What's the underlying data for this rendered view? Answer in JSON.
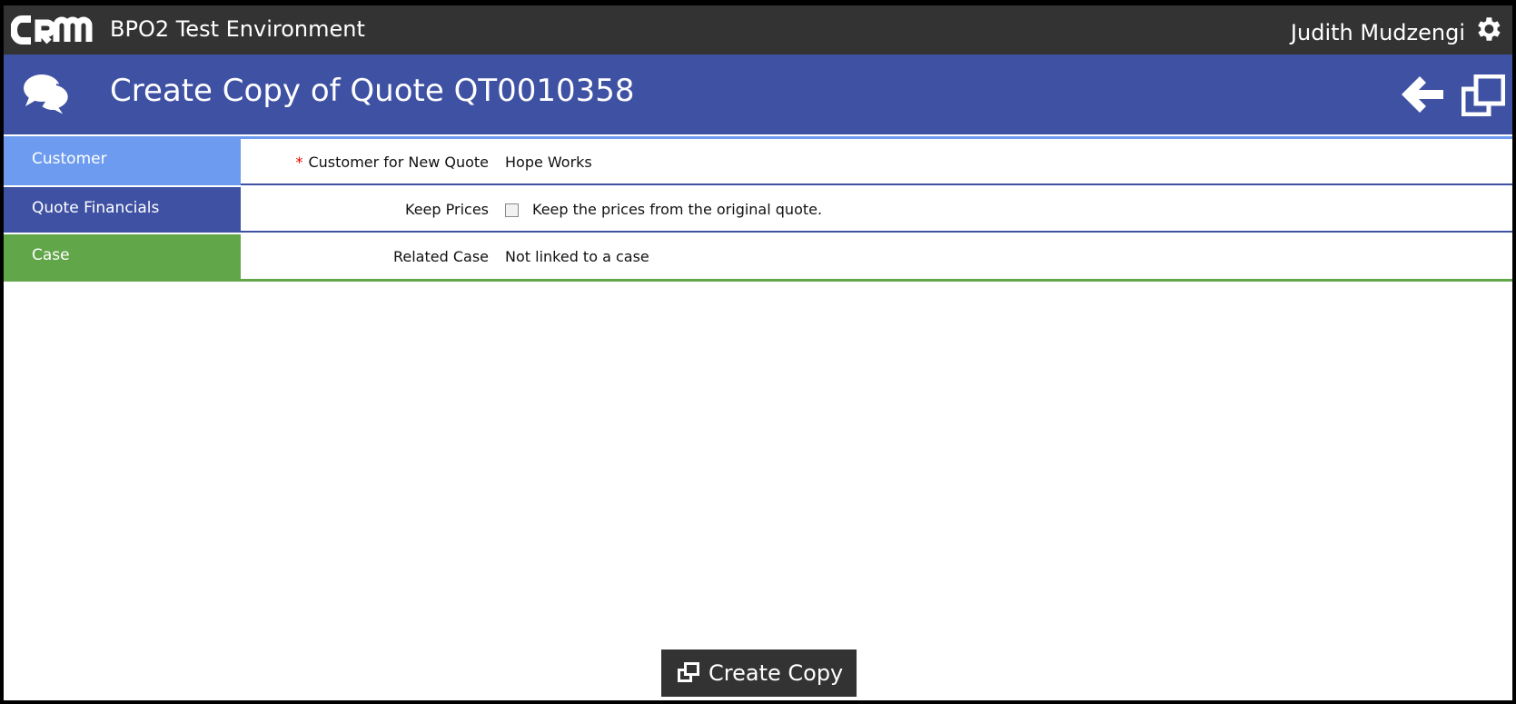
{
  "topbar": {
    "logo": "CRM",
    "environment": "BPO2 Test Environment",
    "user": "Judith Mudzengi"
  },
  "titlebar": {
    "title": "Create Copy of Quote QT0010358"
  },
  "sections": [
    {
      "label": "Customer",
      "color": "#6d9bef",
      "field_label": "Customer for New Quote",
      "required_marker": "*",
      "value": "Hope Works"
    },
    {
      "label": "Quote Financials",
      "color": "#3f51a3",
      "field_label": "Keep Prices",
      "checkbox_checked": false,
      "checkbox_text": "Keep the prices from the original quote."
    },
    {
      "label": "Case",
      "color": "#62a64a",
      "field_label": "Related Case",
      "value": "Not linked to a case"
    }
  ],
  "footer": {
    "create_copy_label": "Create Copy"
  }
}
